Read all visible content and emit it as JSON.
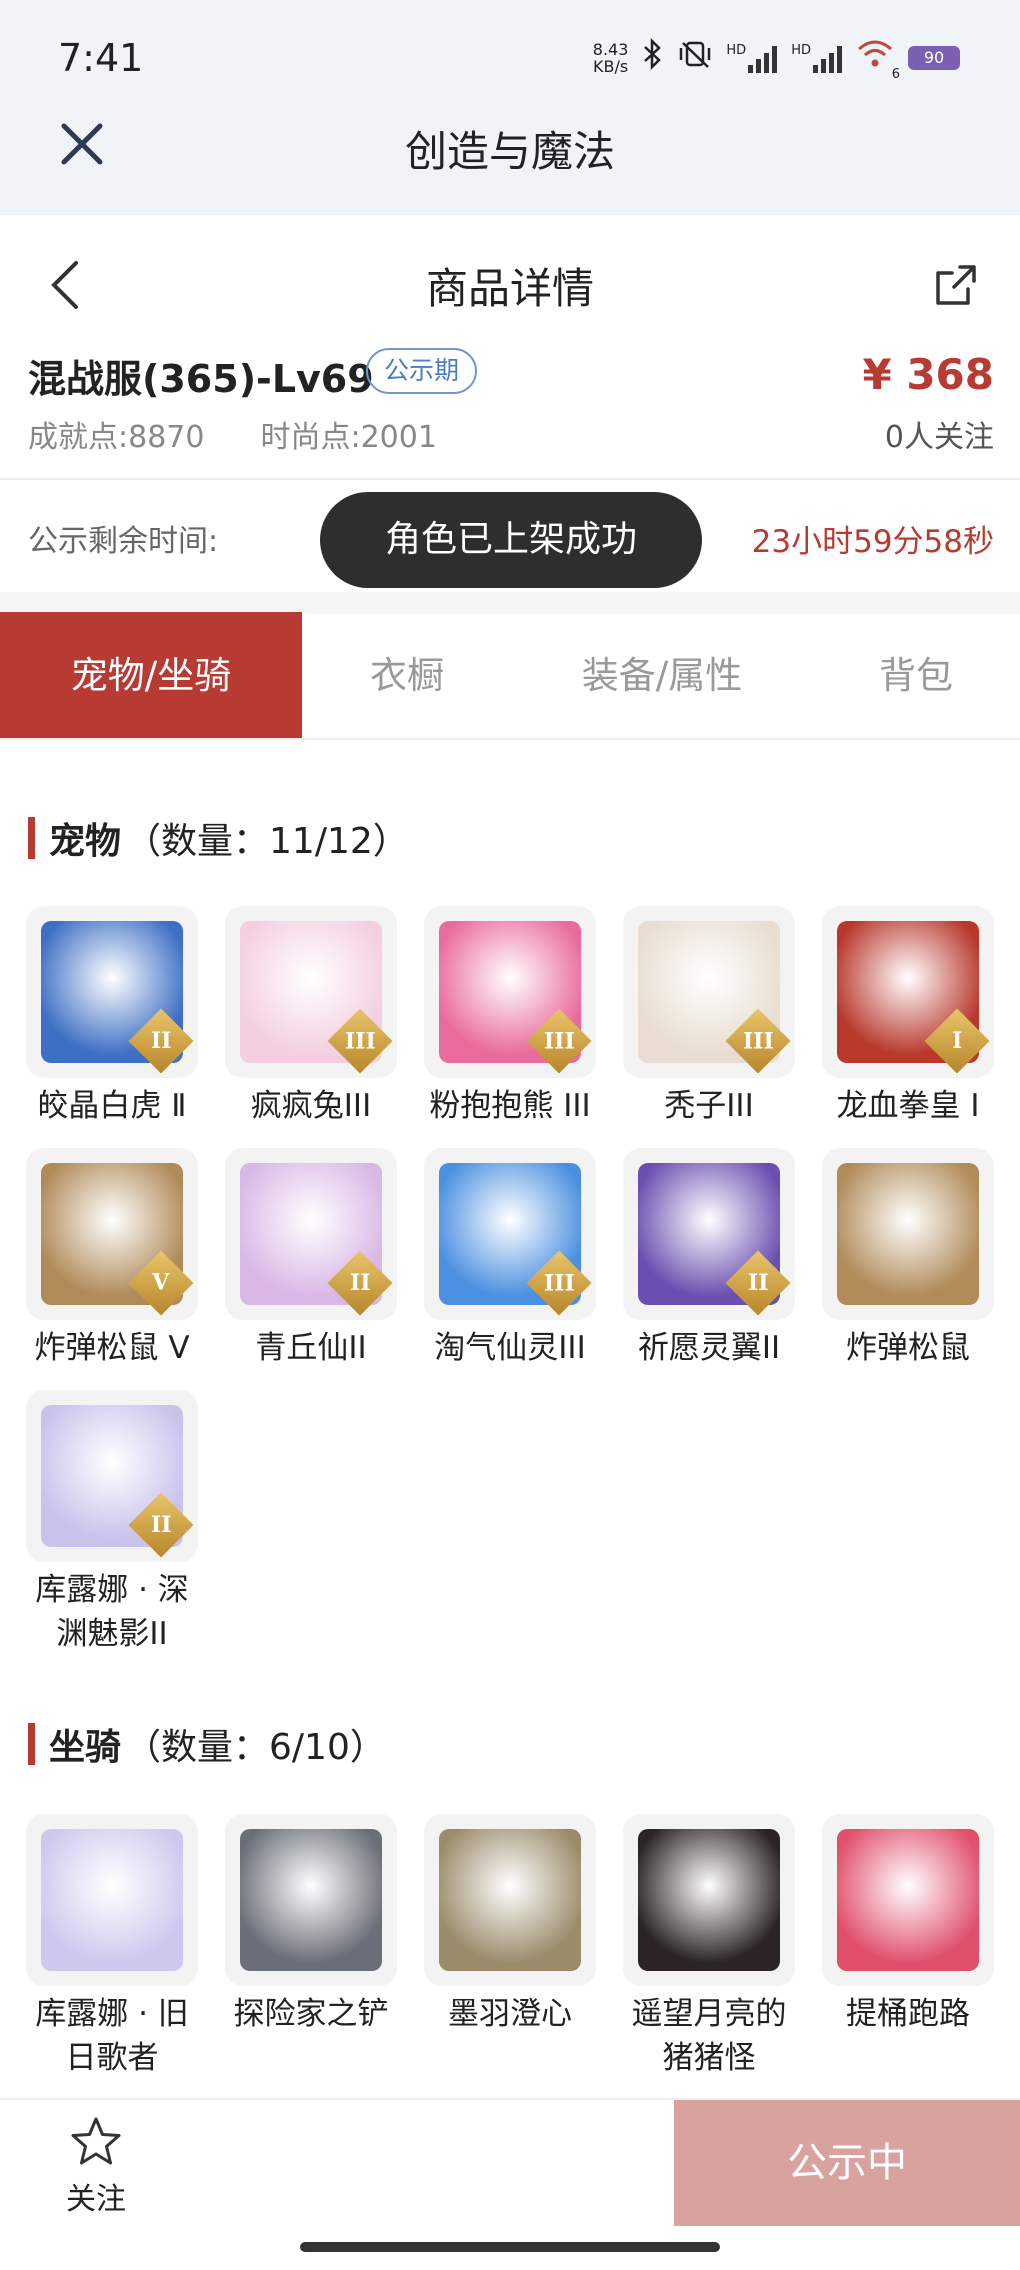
{
  "status_bar": {
    "time": "7:41",
    "net_speed_value": "8.43",
    "net_speed_unit": "KB/s",
    "hd1": "HD",
    "hd2": "HD",
    "wifi_badge": "6",
    "battery": "90"
  },
  "app": {
    "title": "创造与魔法"
  },
  "header": {
    "title": "商品详情"
  },
  "product": {
    "name": "混战服(365)-Lv69",
    "badge": "公示期",
    "price": "¥ 368",
    "achievement_label": "成就点:",
    "achievement_value": "8870",
    "fashion_label": "时尚点:",
    "fashion_value": "2001",
    "followers": "0人关注"
  },
  "notice": {
    "label": "公示剩余时间:",
    "toast": "角色已上架成功",
    "countdown": "23小时59分58秒"
  },
  "tabs": [
    {
      "label": "宠物/坐骑",
      "active": true
    },
    {
      "label": "衣橱",
      "active": false
    },
    {
      "label": "装备/属性",
      "active": false
    },
    {
      "label": "背包",
      "active": false
    }
  ],
  "pets": {
    "title": "宠物",
    "count": "（数量：11/12）",
    "items": [
      {
        "name": "皎晶白虎 Ⅱ",
        "tier": "II",
        "color": "#3d6fc4"
      },
      {
        "name": "疯疯兔III",
        "tier": "III",
        "color": "#f3cfe0"
      },
      {
        "name": "粉抱抱熊 III",
        "tier": "III",
        "color": "#e96a9c"
      },
      {
        "name": "秃子III",
        "tier": "III",
        "color": "#e8ddd0"
      },
      {
        "name": "龙血拳皇 I",
        "tier": "I",
        "color": "#b8382c"
      },
      {
        "name": "炸弹松鼠 V",
        "tier": "V",
        "color": "#b08a58"
      },
      {
        "name": "青丘仙II",
        "tier": "II",
        "color": "#d9b7e6"
      },
      {
        "name": "淘气仙灵III",
        "tier": "III",
        "color": "#4a8fe0"
      },
      {
        "name": "祈愿灵翼II",
        "tier": "II",
        "color": "#6b4fb0"
      },
      {
        "name": "炸弹松鼠",
        "tier": "",
        "color": "#b08a58"
      },
      {
        "name": "库露娜 · 深渊魅影II",
        "tier": "II",
        "color": "#c9c3ec"
      }
    ]
  },
  "mounts": {
    "title": "坐骑",
    "count": "（数量：6/10）",
    "items": [
      {
        "name": "库露娜 · 旧日歌者",
        "color": "#cfc8ee"
      },
      {
        "name": "探险家之铲",
        "color": "#6a6e78"
      },
      {
        "name": "墨羽澄心",
        "color": "#9a8b6a"
      },
      {
        "name": "遥望月亮的猪猪怪",
        "color": "#2b2326"
      },
      {
        "name": "提桶跑路",
        "color": "#e0506c"
      }
    ]
  },
  "bottom": {
    "follow_label": "关注",
    "status_label": "公示中"
  }
}
